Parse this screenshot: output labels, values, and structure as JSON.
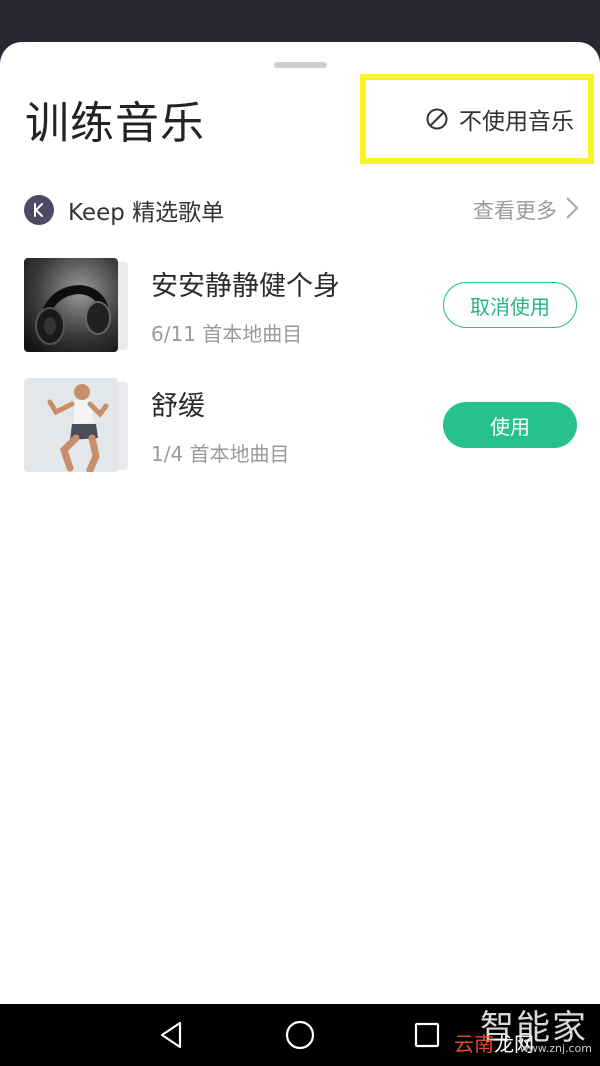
{
  "sheet": {
    "title": "训练音乐",
    "no_music": {
      "icon": "ban-icon",
      "label": "不使用音乐",
      "highlight_color": "#f7f526"
    }
  },
  "section": {
    "logo_icon": "keep-k-icon",
    "title": "Keep 精选歌单",
    "see_more": "查看更多",
    "see_more_icon": "chevron-right-icon"
  },
  "playlists": [
    {
      "name": "安安静静健个身",
      "meta": "6/11 首本地曲目",
      "cover": "headphones-photo",
      "action": "取消使用",
      "action_style": "outline"
    },
    {
      "name": "舒缓",
      "meta": "1/4 首本地曲目",
      "cover": "runner-photo",
      "action": "使用",
      "action_style": "filled"
    }
  ],
  "colors": {
    "accent": "#27c18f",
    "title": "#232323",
    "muted": "#9a9a9a"
  },
  "navbar": {
    "buttons": [
      "back-triangle-icon",
      "home-circle-icon",
      "recents-square-icon"
    ]
  },
  "watermark": {
    "top": "智能家",
    "bottom_red": "云南",
    "bottom_white": "龙网",
    "url": "www.znj.com"
  }
}
